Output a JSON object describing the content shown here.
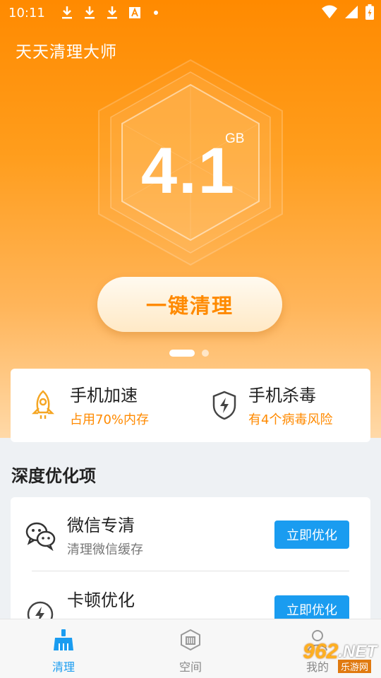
{
  "status_bar": {
    "time": "10:11"
  },
  "header": {
    "app_title": "天天清理大师"
  },
  "storage": {
    "value": "4.1",
    "unit": "GB"
  },
  "clean_button": {
    "label": "一键清理"
  },
  "pager": {
    "page_count": 2,
    "active_index": 0
  },
  "quick_actions": [
    {
      "title": "手机加速",
      "subtitle": "占用70%内存",
      "icon": "rocket-icon"
    },
    {
      "title": "手机杀毒",
      "subtitle": "有4个病毒风险",
      "icon": "shield-icon"
    }
  ],
  "deep_optimize": {
    "section_title": "深度优化项",
    "items": [
      {
        "title": "微信专清",
        "subtitle": "清理微信缓存",
        "button": "立即优化",
        "icon": "wechat-icon"
      },
      {
        "title": "卡顿优化",
        "subtitle": "",
        "button": "立即优化",
        "icon": "lightning-icon"
      }
    ]
  },
  "tabbar": {
    "tabs": [
      {
        "label": "清理",
        "icon": "broom-icon",
        "active": true
      },
      {
        "label": "空间",
        "icon": "storage-icon",
        "active": false
      },
      {
        "label": "我的",
        "icon": "profile-icon",
        "active": false
      }
    ]
  },
  "watermark": {
    "logo": "962",
    "suffix": ".NET",
    "sub": "乐游网"
  },
  "colors": {
    "accent_orange": "#ff8a00",
    "button_blue": "#1a9cf0"
  }
}
